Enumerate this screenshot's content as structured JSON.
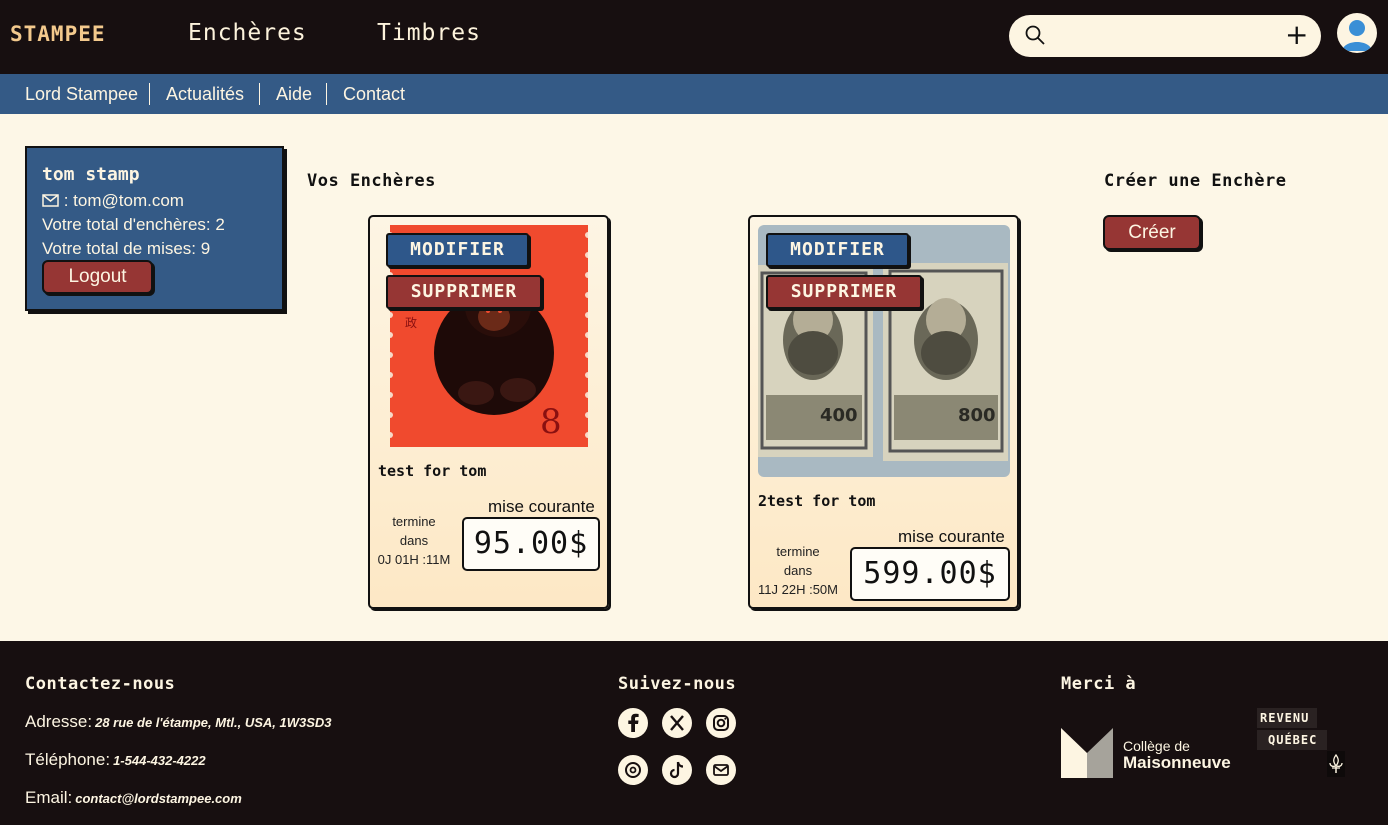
{
  "header": {
    "logo": "STAMPEE",
    "nav": [
      "Enchères",
      "Timbres"
    ],
    "search": {
      "placeholder": ""
    },
    "add_label": "+"
  },
  "subnav": [
    "Lord Stampee",
    "Actualités",
    "Aide",
    "Contact"
  ],
  "profile": {
    "name": "tom stamp",
    "email": ": tom@tom.com",
    "total_encheres": "Votre total d'enchères: 2",
    "total_mises": "Votre total de mises: 9",
    "logout": "Logout"
  },
  "auctions": {
    "title": "Vos Enchères",
    "items": [
      {
        "modify": "MODIFIER",
        "delete": "SUPPRIMER",
        "title": "test for tom",
        "mise_label": "mise courante",
        "price": "95.00$",
        "termine": "termine",
        "dans": "dans",
        "time_left": "0J 01H :11M",
        "stamp_value": "8",
        "stamp_char": "政"
      },
      {
        "modify": "MODIFIER",
        "delete": "SUPPRIMER",
        "title": "2test for tom",
        "mise_label": "mise courante",
        "price": "599.00$",
        "termine": "termine",
        "dans": "dans",
        "time_left": "11J 22H :50M",
        "stamp_value_left": "400",
        "stamp_value_right": "800"
      }
    ]
  },
  "create": {
    "title": "Créer une Enchère",
    "button": "Créer"
  },
  "footer": {
    "contact_title": "Contactez-nous",
    "address_label": "Adresse:",
    "address": "28 rue de l'étampe, Mtl., USA, 1W3SD3",
    "phone_label": "Téléphone:",
    "phone": "1-544-432-4222",
    "email_label": "Email:",
    "email": "contact@lordstampee.com",
    "follow_title": "Suivez-nous",
    "social": [
      "facebook-icon",
      "x-icon",
      "instagram-icon",
      "threads-icon",
      "tiktok-icon",
      "mail-icon"
    ],
    "thanks_title": "Merci à",
    "college_line1": "Collège de",
    "college_line2": "Maisonneuve",
    "rq_line1": "REVENU",
    "rq_line2": "QUÉBEC"
  },
  "colors": {
    "dark": "#170f10",
    "blue": "#345a86",
    "red": "#963634",
    "cream": "#fdf7e7",
    "gold": "#f3c98d"
  }
}
